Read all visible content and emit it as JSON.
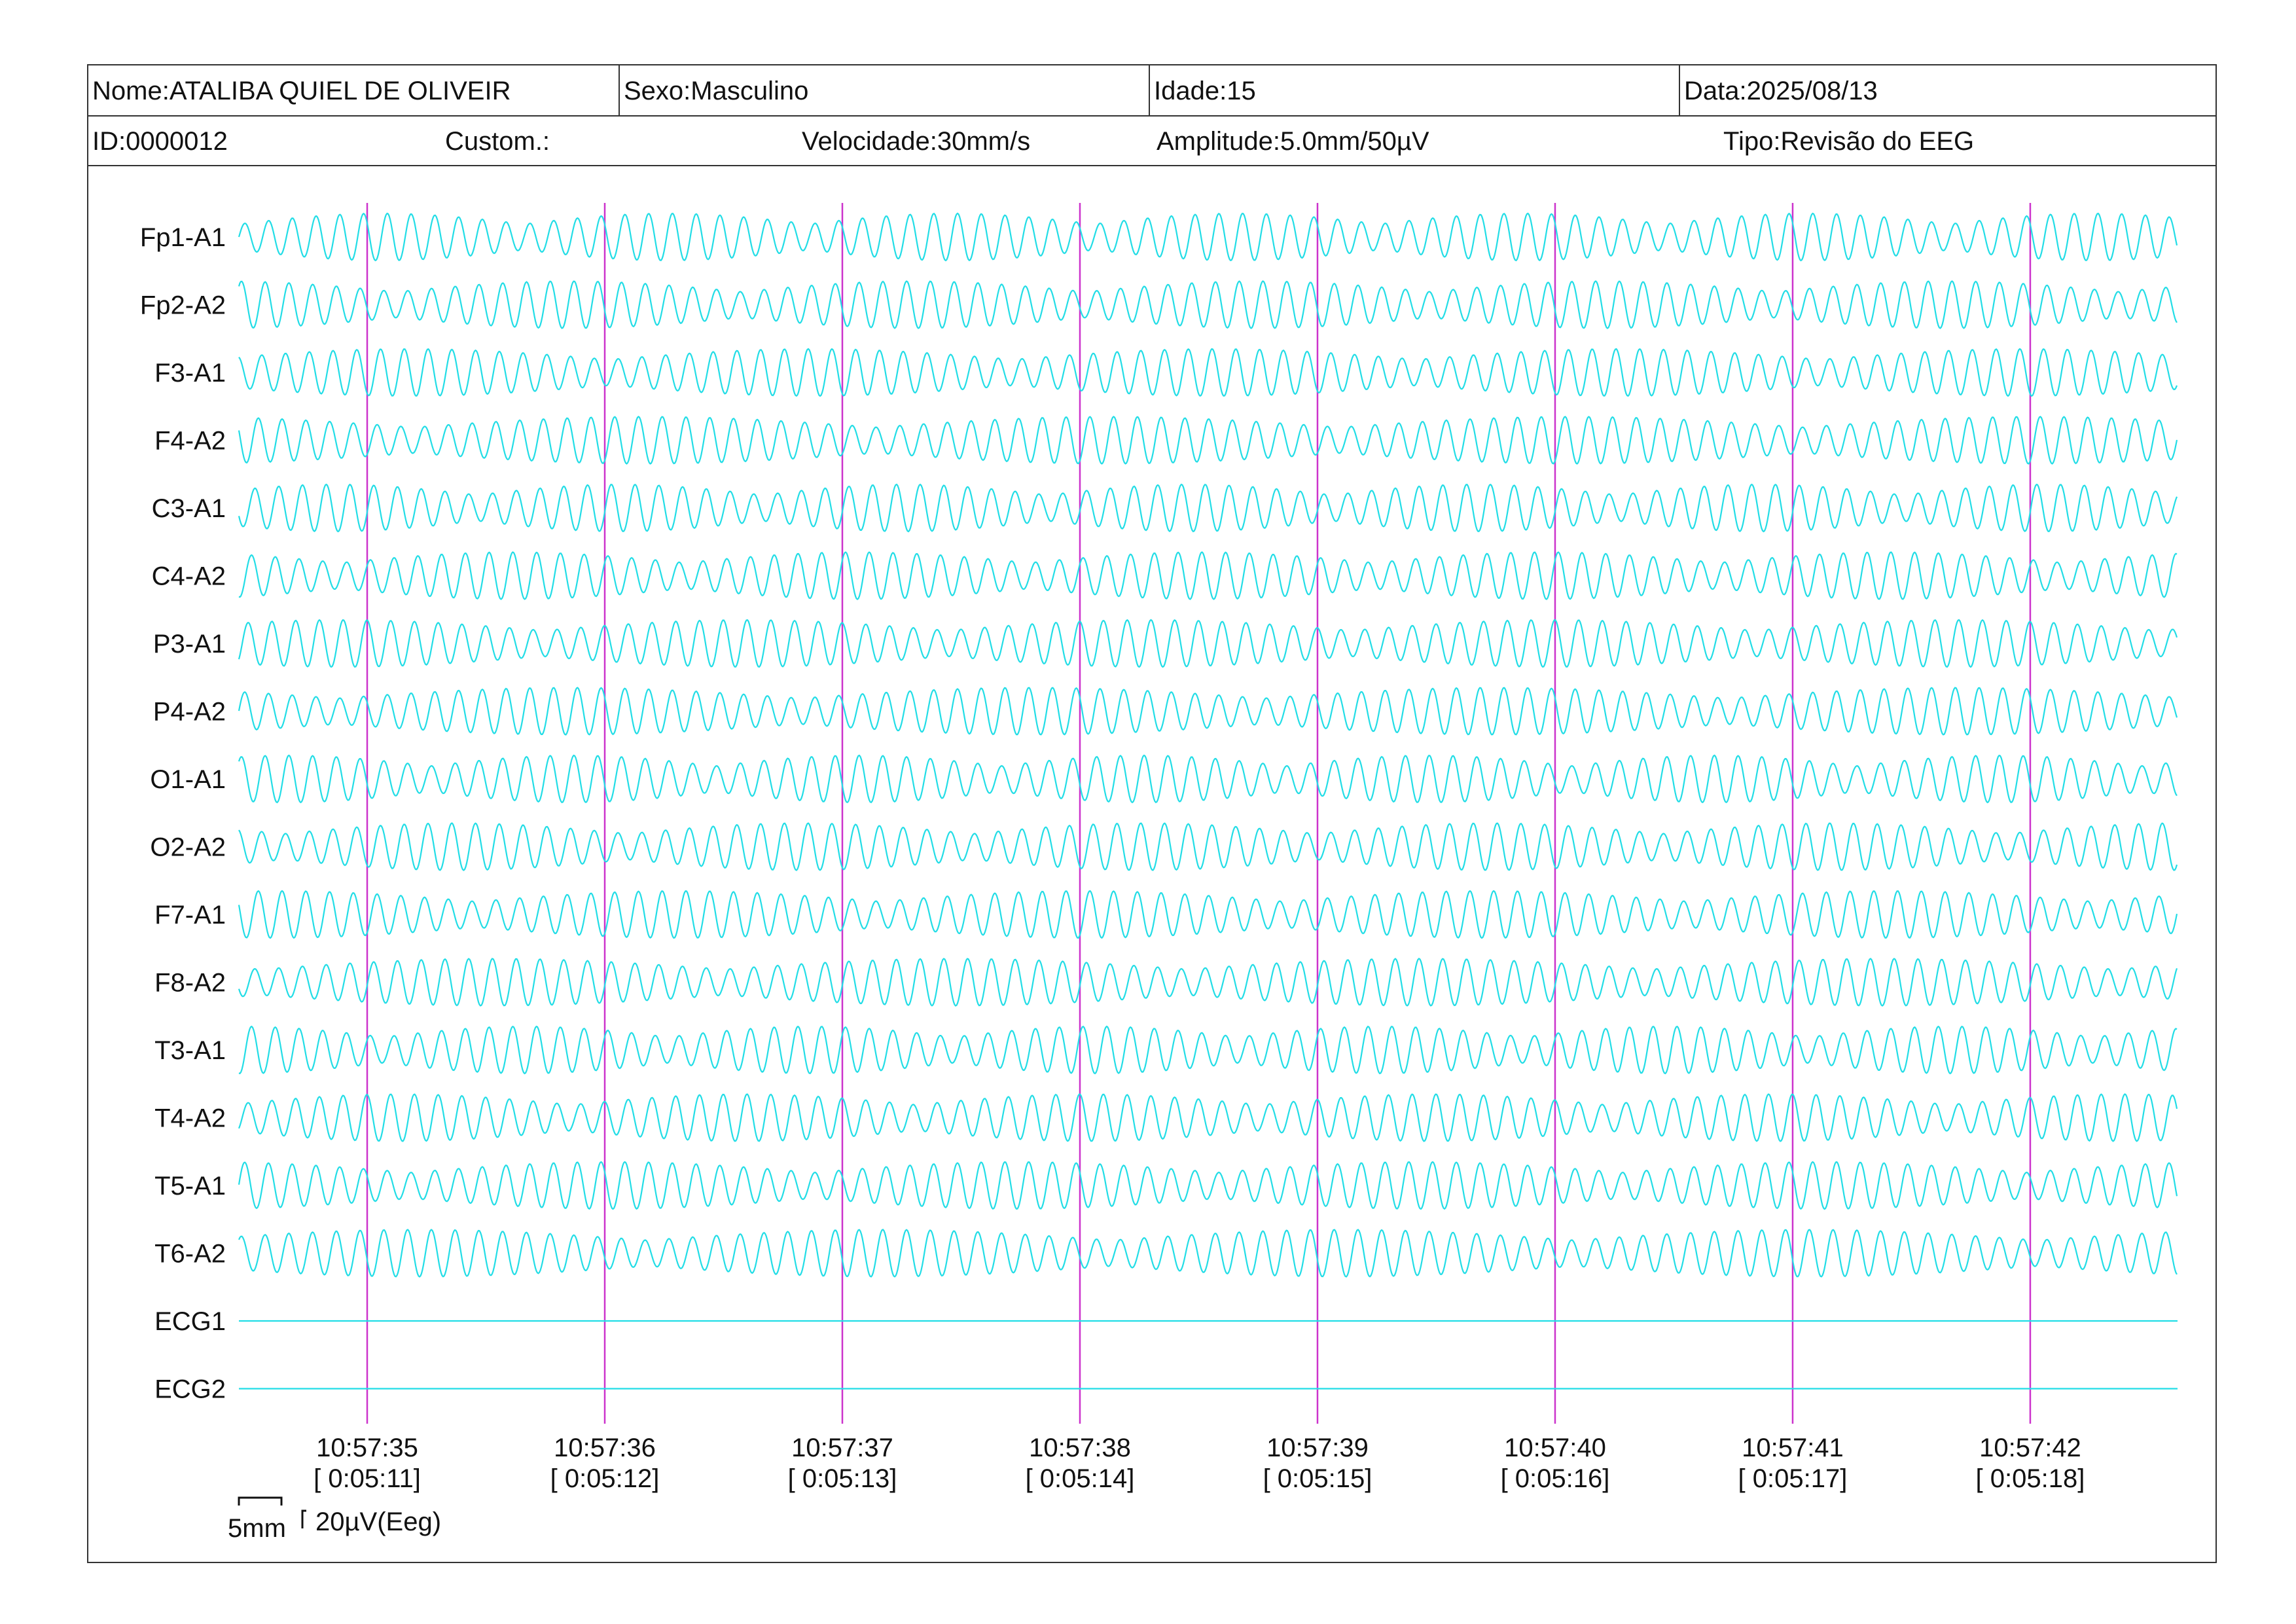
{
  "header": {
    "nome": "Nome:ATALIBA QUIEL DE OLIVEIR",
    "sexo": "Sexo:Masculino",
    "idade": "Idade:15",
    "data": "Data:2025/08/13",
    "id": "ID:0000012",
    "custom": "Custom.:",
    "velocidade": "Velocidade:30mm/s",
    "amplitude": "Amplitude:5.0mm/50µV",
    "tipo": "Tipo:Revisão do EEG"
  },
  "scale": {
    "time_label": "5mm",
    "amp_label": "20µV(Eeg)"
  },
  "colors": {
    "trace": "#22dde6",
    "marker": "#cc33cc",
    "border": "#333333"
  },
  "chart_data": {
    "type": "line",
    "channels": [
      "Fp1-A1",
      "Fp2-A2",
      "F3-A1",
      "F4-A2",
      "C3-A1",
      "C4-A2",
      "P3-A1",
      "P4-A2",
      "O1-A1",
      "O2-A2",
      "F7-A1",
      "F8-A2",
      "T3-A1",
      "T4-A2",
      "T5-A1",
      "T6-A2",
      "ECG1",
      "ECG2"
    ],
    "flat_channels": [
      "ECG1",
      "ECG2"
    ],
    "time_ticks": [
      {
        "clock": "10:57:35",
        "elapsed": "[ 0:05:11]"
      },
      {
        "clock": "10:57:36",
        "elapsed": "[ 0:05:12]"
      },
      {
        "clock": "10:57:37",
        "elapsed": "[ 0:05:13]"
      },
      {
        "clock": "10:57:38",
        "elapsed": "[ 0:05:14]"
      },
      {
        "clock": "10:57:39",
        "elapsed": "[ 0:05:15]"
      },
      {
        "clock": "10:57:40",
        "elapsed": "[ 0:05:16]"
      },
      {
        "clock": "10:57:41",
        "elapsed": "[ 0:05:17]"
      },
      {
        "clock": "10:57:42",
        "elapsed": "[ 0:05:18]"
      }
    ],
    "xlim_seconds": [
      -0.54,
      7.62
    ],
    "wave_frequency_hz": 10,
    "grid": false
  }
}
